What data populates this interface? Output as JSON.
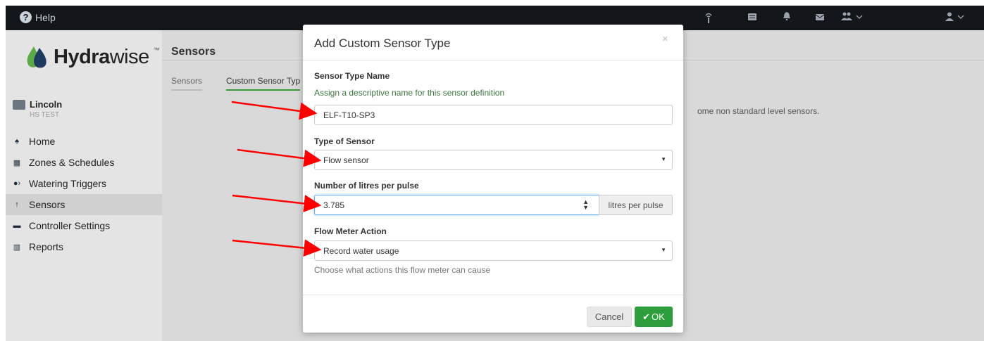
{
  "topbar": {
    "help_label": "Help",
    "help_icon_glyph": "?",
    "icons": [
      "sensor-icon",
      "list-icon",
      "bell-icon",
      "mail-icon",
      "users-icon",
      "user-icon"
    ]
  },
  "sidebar": {
    "logo": {
      "bold": "Hydra",
      "regular": "wise",
      "tm": "™"
    },
    "controller": {
      "name": "Lincoln",
      "subtitle": "HS TEST"
    },
    "items": [
      {
        "label": "Home",
        "icon": "home-icon",
        "glyph": "♠"
      },
      {
        "label": "Zones & Schedules",
        "icon": "zones-icon",
        "glyph": "▦"
      },
      {
        "label": "Watering Triggers",
        "icon": "triggers-icon",
        "glyph": "●›"
      },
      {
        "label": "Sensors",
        "icon": "sensor-icon",
        "glyph": "↑"
      },
      {
        "label": "Controller Settings",
        "icon": "controller-icon",
        "glyph": "▬"
      },
      {
        "label": "Reports",
        "icon": "reports-icon",
        "glyph": "▥"
      }
    ],
    "active_item": "Sensors"
  },
  "main": {
    "title": "Sensors",
    "tabs": [
      {
        "label": "Sensors",
        "active": false
      },
      {
        "label": "Custom Sensor Typ",
        "active": true
      }
    ],
    "background_text": "ome non standard level sensors."
  },
  "modal": {
    "title": "Add Custom Sensor Type",
    "close_glyph": "×",
    "sensor_type_name": {
      "label": "Sensor Type Name",
      "hint": "Assign a descriptive name for this sensor definition",
      "value": "ELF-T10-SP3"
    },
    "type_of_sensor": {
      "label": "Type of Sensor",
      "value": "Flow sensor"
    },
    "litres_per_pulse": {
      "label": "Number of litres per pulse",
      "value": "3.785",
      "unit_addon": "litres per pulse"
    },
    "flow_meter_action": {
      "label": "Flow Meter Action",
      "value": "Record water usage",
      "hint": "Choose what actions this flow meter can cause"
    },
    "buttons": {
      "cancel": "Cancel",
      "ok": "OK",
      "ok_check": "✔"
    }
  },
  "colors": {
    "topbar_bg": "#14171a",
    "accent_green": "#2e9d3b",
    "hint_green": "#3c763d",
    "arrow_red": "#ff0000"
  }
}
